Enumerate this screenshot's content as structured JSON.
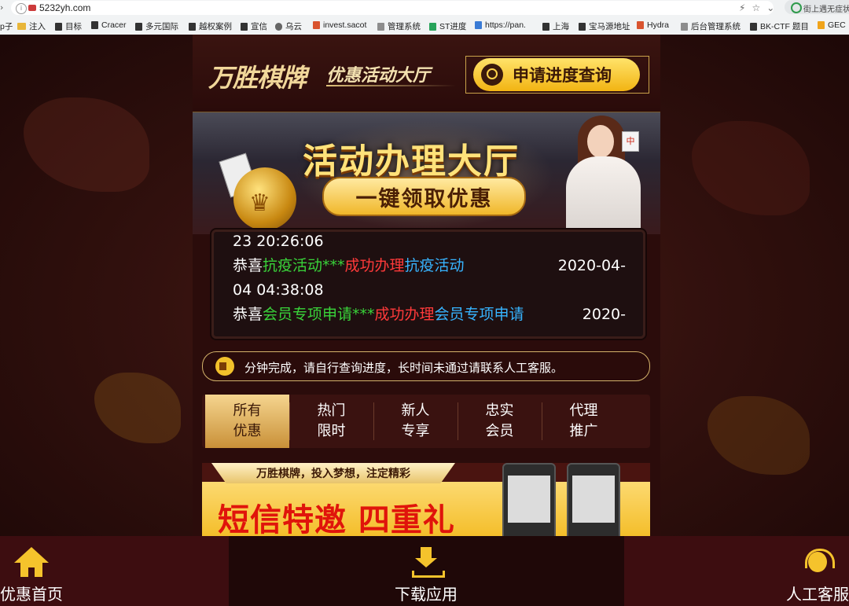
{
  "browser": {
    "url": "5232yh.com",
    "extension_text": "街上遇无症状",
    "bookmarks": [
      {
        "label": "p子",
        "icon": "none"
      },
      {
        "label": "注入",
        "icon": "folder"
      },
      {
        "label": "目标",
        "icon": "file"
      },
      {
        "label": "Cracer",
        "icon": "file"
      },
      {
        "label": "多元国际",
        "icon": "file"
      },
      {
        "label": "越权案例",
        "icon": "file"
      },
      {
        "label": "宣信",
        "icon": "file"
      },
      {
        "label": "乌云",
        "icon": "cloud"
      },
      {
        "label": "invest.sacot",
        "icon": "red"
      },
      {
        "label": "管理系统",
        "icon": "grey"
      },
      {
        "label": "ST进度",
        "icon": "green"
      },
      {
        "label": "https://pan.",
        "icon": "blue"
      },
      {
        "label": "上海",
        "icon": "file"
      },
      {
        "label": "宝马源地址",
        "icon": "file"
      },
      {
        "label": "Hydra",
        "icon": "red"
      },
      {
        "label": "后台管理系统",
        "icon": "grey"
      },
      {
        "label": "BK-CTF 题目",
        "icon": "file"
      },
      {
        "label": "GEC",
        "icon": "orange"
      }
    ]
  },
  "header": {
    "logo_main": "万胜棋牌",
    "logo_sub": "优惠活动大厅",
    "query_button": "申请进度查询"
  },
  "banner": {
    "title": "活动办理大厅",
    "subtitle": "一键领取优惠",
    "mahjong_tile": "中"
  },
  "ticker": {
    "lines": [
      {
        "prefix": "",
        "name": "",
        "status": "",
        "activity": "",
        "date": "23 20:26:06"
      },
      {
        "prefix": "恭喜",
        "name": "抗疫活动***",
        "status": "成功办理",
        "activity": "抗疫活动",
        "date": "2020-04-"
      },
      {
        "prefix": "",
        "name": "",
        "status": "",
        "activity": "",
        "date": "04 04:38:08"
      },
      {
        "prefix": "恭喜",
        "name": "会员专项申请***",
        "status": "成功办理",
        "activity": "会员专项申请",
        "date": "2020-"
      }
    ]
  },
  "notice": {
    "text": "分钟完成，请自行查询进度，长时间未通过请联系人工客服。"
  },
  "tabs": [
    {
      "line1": "所有",
      "line2": "优惠",
      "active": true
    },
    {
      "line1": "热门",
      "line2": "限时",
      "active": false
    },
    {
      "line1": "新人",
      "line2": "专享",
      "active": false
    },
    {
      "line1": "忠实",
      "line2": "会员",
      "active": false
    },
    {
      "line1": "代理",
      "line2": "推广",
      "active": false
    }
  ],
  "promo": {
    "slogan": "万胜棋牌，投入梦想，注定精彩",
    "headline": "短信特邀 四重礼"
  },
  "bottom_nav": {
    "home": "优惠首页",
    "download": "下载应用",
    "service": "人工客服"
  },
  "colors": {
    "accent_gold": "#f5c32c",
    "ticker_green": "#39d33a",
    "ticker_red": "#ff3a3a",
    "ticker_blue": "#37b4ff",
    "promo_red": "#e0140b"
  }
}
